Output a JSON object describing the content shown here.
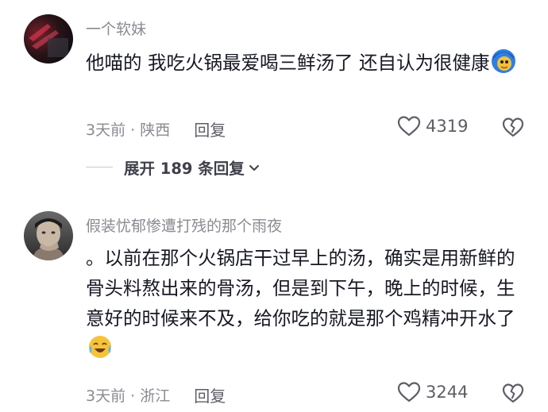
{
  "comments": [
    {
      "username": "一个软妹",
      "text": "他喵的 我吃火锅最爱喝三鲜汤了 还自认为很健康",
      "emoji": "blue-hair-face-emoji",
      "time_location": "3天前 · 陕西",
      "reply_label": "回复",
      "likes": "4319",
      "avatar": "red-dark-avatar"
    },
    {
      "username": "假装忧郁惨遭打残的那个雨夜",
      "text": "。以前在那个火锅店干过早上的汤，确实是用新鲜的骨头料熬出来的骨汤，但是到下午，晚上的时候，生意好的时候来不及，给你吃的就是那个鸡精冲开水了",
      "emoji": "crying-laughing-emoji",
      "time_location": "3天前 · 浙江",
      "reply_label": "回复",
      "likes": "3244",
      "avatar": "person-portrait-avatar"
    }
  ],
  "expand_replies": "展开 189 条回复",
  "icons": {
    "like": "heart-outline-icon",
    "dislike": "broken-heart-icon",
    "expand": "chevron-down-icon"
  },
  "colors": {
    "secondary_text": "#8a8b91",
    "primary_text": "#161823"
  }
}
